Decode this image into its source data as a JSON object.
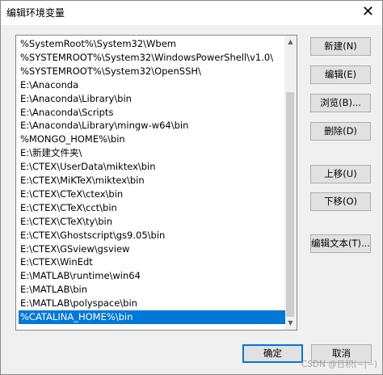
{
  "window": {
    "title": "编辑环境变量",
    "close_glyph": "✕"
  },
  "env_list": {
    "items": [
      "%SystemRoot%\\System32\\Wbem",
      "%SYSTEMROOT%\\System32\\WindowsPowerShell\\v1.0\\",
      "%SYSTEMROOT%\\System32\\OpenSSH\\",
      "E:\\Anaconda",
      "E:\\Anaconda\\Library\\bin",
      "E:\\Anaconda\\Scripts",
      "E:\\Anaconda\\Library\\mingw-w64\\bin",
      "%MONGO_HOME%\\bin",
      "E:\\新建文件夹\\",
      "E:\\CTEX\\UserData\\miktex\\bin",
      "E:\\CTEX\\MiKTeX\\miktex\\bin",
      "E:\\CTEX\\CTeX\\ctex\\bin",
      "E:\\CTEX\\CTeX\\cct\\bin",
      "E:\\CTEX\\CTeX\\ty\\bin",
      "E:\\CTEX\\Ghostscript\\gs9.05\\bin",
      "E:\\CTEX\\GSview\\gsview",
      "E:\\CTEX\\WinEdt",
      "E:\\MATLAB\\runtime\\win64",
      "E:\\MATLAB\\bin",
      "E:\\MATLAB\\polyspace\\bin",
      "%CATALINA_HOME%\\bin"
    ],
    "selected_index": 20
  },
  "buttons": {
    "new": "新建(N)",
    "edit": "编辑(E)",
    "browse": "浏览(B)...",
    "delete": "删除(D)",
    "move_up": "上移(U)",
    "move_down": "下移(O)",
    "edit_text": "编辑文本(T)...",
    "ok": "确定",
    "cancel": "取消"
  },
  "scrollbar": {
    "up_glyph": "▲",
    "down_glyph": "▼"
  },
  "watermark": "CSDN @日积(~|~)"
}
